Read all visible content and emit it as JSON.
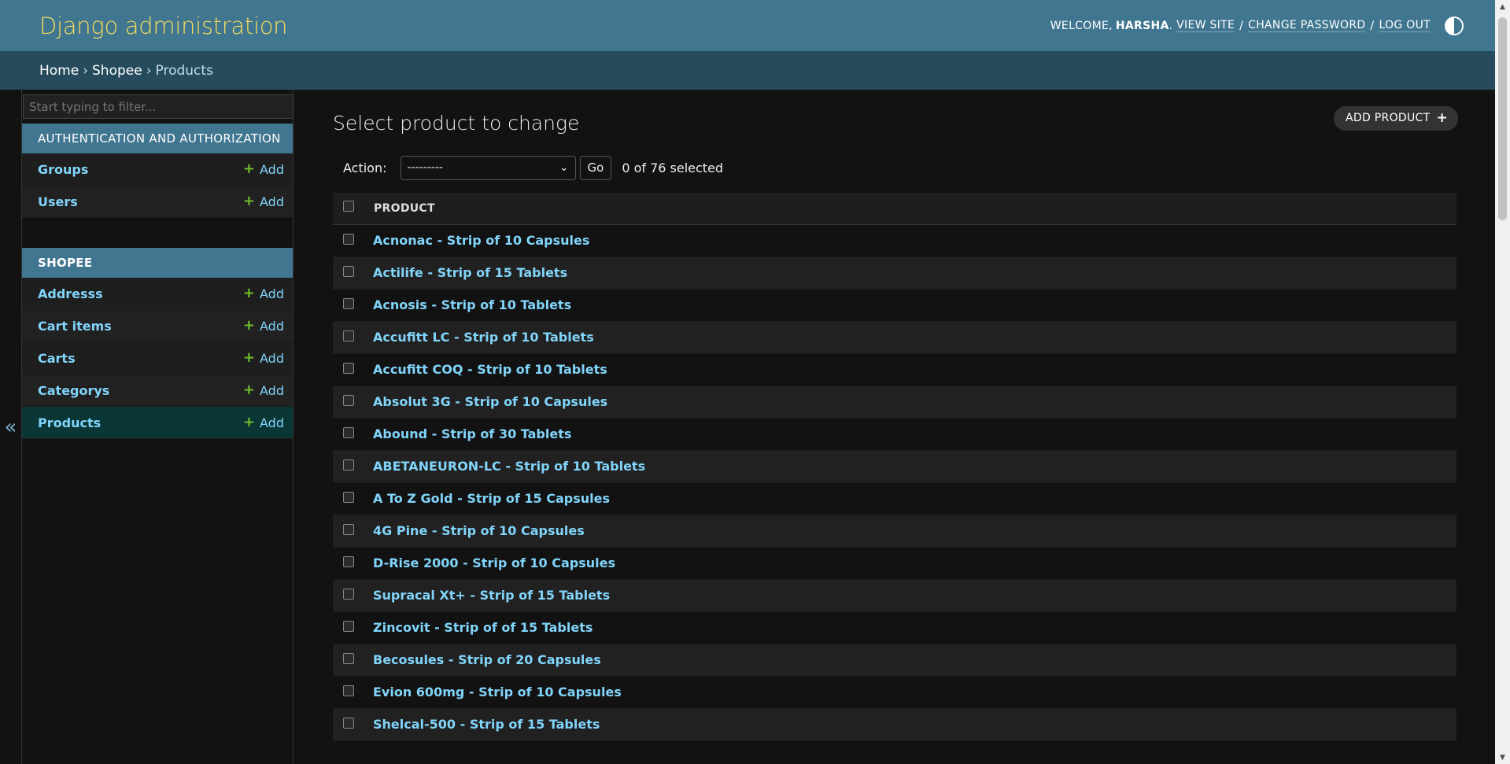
{
  "header": {
    "branding": "Django administration",
    "welcome": "WELCOME,",
    "username": "HARSHA",
    "view_site": "VIEW SITE",
    "change_password": "CHANGE PASSWORD",
    "log_out": "LOG OUT",
    "theme_icon": "theme-toggle-icon"
  },
  "breadcrumbs": [
    "Home",
    "Shopee",
    "Products"
  ],
  "sidebar": {
    "filter_placeholder": "Start typing to filter...",
    "collapse_icon": "«",
    "modules": [
      {
        "caption": "AUTHENTICATION AND AUTHORIZATION",
        "models": [
          {
            "name": "Groups",
            "add": "Add"
          },
          {
            "name": "Users",
            "add": "Add"
          }
        ]
      },
      {
        "caption": "SHOPEE",
        "models": [
          {
            "name": "Addresss",
            "add": "Add"
          },
          {
            "name": "Cart items",
            "add": "Add"
          },
          {
            "name": "Carts",
            "add": "Add"
          },
          {
            "name": "Categorys",
            "add": "Add"
          },
          {
            "name": "Products",
            "add": "Add",
            "active": true
          }
        ]
      }
    ]
  },
  "main": {
    "title": "Select product to change",
    "add_button": "ADD PRODUCT",
    "action_label": "Action:",
    "action_selected": "---------",
    "go_button": "Go",
    "selected_count": "0 of 76 selected",
    "column_header": "PRODUCT",
    "rows": [
      "Acnonac - Strip of 10 Capsules",
      "Actilife - Strip of 15 Tablets",
      "Acnosis - Strip of 10 Tablets",
      "Accufitt LC - Strip of 10 Tablets",
      "Accufitt COQ - Strip of 10 Tablets",
      "Absolut 3G - Strip of 10 Capsules",
      "Abound - Strip of 30 Tablets",
      "ABETANEURON-LC - Strip of 10 Tablets",
      "A To Z Gold - Strip of 15 Capsules",
      "4G Pine - Strip of 10 Capsules",
      "D-Rise 2000 - Strip of 10 Capsules",
      "Supracal Xt+ - Strip of 15 Tablets",
      "Zincovit - Strip of of 15 Tablets",
      "Becosules - Strip of 20 Capsules",
      "Evion 600mg - Strip of 10 Capsules",
      "Shelcal-500 - Strip of 15 Tablets"
    ]
  },
  "colors": {
    "header_bg": "#417690",
    "breadcrumb_bg": "#264b5d",
    "branding": "#f5dd5d",
    "link": "#81d4fa",
    "add_plus": "#70bf2b",
    "active_row": "#0a3636"
  }
}
